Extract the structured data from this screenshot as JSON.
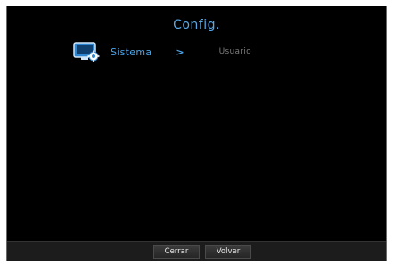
{
  "window": {
    "title": "Config."
  },
  "breadcrumb": {
    "icon": "monitor-gear-icon",
    "main_label": "Sistema",
    "separator": ">",
    "sub_label": "Usuario"
  },
  "footer": {
    "close_label": "Cerrar",
    "back_label": "Volver"
  },
  "colors": {
    "background": "#000000",
    "accent": "#4aa6ec",
    "muted_text": "#7c7c7c",
    "footer_bg": "#1c1c1c"
  }
}
